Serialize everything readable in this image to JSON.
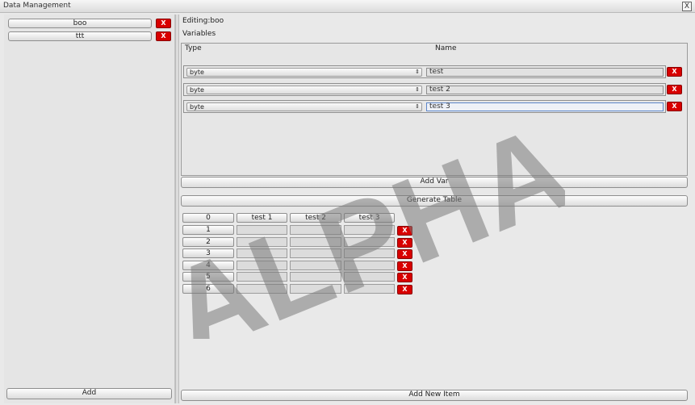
{
  "window": {
    "title": "Data Management",
    "close_label": "X"
  },
  "left_panel": {
    "items": [
      {
        "label": "boo",
        "remove_label": "X"
      },
      {
        "label": "ttt",
        "remove_label": "X"
      }
    ],
    "add_label": "Add"
  },
  "editor": {
    "editing_label": "Editing:boo",
    "variables_label": "Variables",
    "columns": {
      "type": "Type",
      "name": "Name"
    },
    "variables": [
      {
        "type": "byte",
        "name": "test",
        "remove_label": "X",
        "focused": false
      },
      {
        "type": "byte",
        "name": "test 2",
        "remove_label": "X",
        "focused": false
      },
      {
        "type": "byte",
        "name": "test 3",
        "remove_label": "X",
        "focused": true
      }
    ],
    "add_var_label": "Add Var",
    "generate_table_label": "Generate Table"
  },
  "table": {
    "headers": [
      "0",
      "test 1",
      "test 2",
      "test 3"
    ],
    "row_ids": [
      "1",
      "2",
      "3",
      "4",
      "5",
      "6"
    ],
    "remove_label": "X",
    "add_new_item_label": "Add New Item"
  },
  "watermark": {
    "text": "ALPHA",
    "color": "#7a7a7a"
  }
}
